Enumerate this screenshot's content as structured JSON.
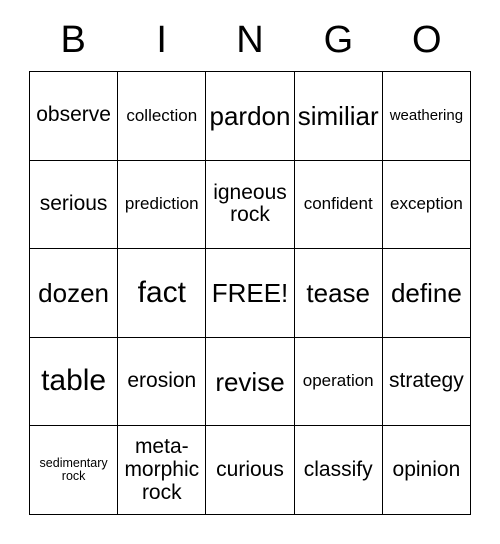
{
  "card": {
    "type": "bingo-card",
    "columns": 5,
    "rows": 5,
    "border_color": "#000000",
    "background_color": "#ffffff",
    "text_color": "#000000"
  },
  "header": {
    "letters": [
      {
        "label": "B"
      },
      {
        "label": "I"
      },
      {
        "label": "N"
      },
      {
        "label": "G"
      },
      {
        "label": "O"
      }
    ]
  },
  "grid": {
    "cells": [
      {
        "text": "observe",
        "size": "md",
        "free": false
      },
      {
        "text": "collection",
        "size": "sm",
        "free": false
      },
      {
        "text": "pardon",
        "size": "lg",
        "free": false
      },
      {
        "text": "similiar",
        "size": "lg",
        "free": false
      },
      {
        "text": "weathering",
        "size": "xs",
        "free": false
      },
      {
        "text": "serious",
        "size": "md",
        "free": false
      },
      {
        "text": "prediction",
        "size": "sm",
        "free": false
      },
      {
        "text": "igneous\nrock",
        "size": "md",
        "free": false
      },
      {
        "text": "confident",
        "size": "sm",
        "free": false
      },
      {
        "text": "exception",
        "size": "sm",
        "free": false
      },
      {
        "text": "dozen",
        "size": "lg",
        "free": false
      },
      {
        "text": "fact",
        "size": "xl",
        "free": false
      },
      {
        "text": "FREE!",
        "size": "lg",
        "free": true
      },
      {
        "text": "tease",
        "size": "lg",
        "free": false
      },
      {
        "text": "define",
        "size": "lg",
        "free": false
      },
      {
        "text": "table",
        "size": "xl",
        "free": false
      },
      {
        "text": "erosion",
        "size": "md",
        "free": false
      },
      {
        "text": "revise",
        "size": "lg",
        "free": false
      },
      {
        "text": "operation",
        "size": "sm",
        "free": false
      },
      {
        "text": "strategy",
        "size": "md",
        "free": false
      },
      {
        "text": "sedimentary\nrock",
        "size": "xxs",
        "free": false
      },
      {
        "text": "meta-\nmorphic\nrock",
        "size": "md",
        "free": false
      },
      {
        "text": "curious",
        "size": "md",
        "free": false
      },
      {
        "text": "classify",
        "size": "md",
        "free": false
      },
      {
        "text": "opinion",
        "size": "md",
        "free": false
      }
    ]
  }
}
